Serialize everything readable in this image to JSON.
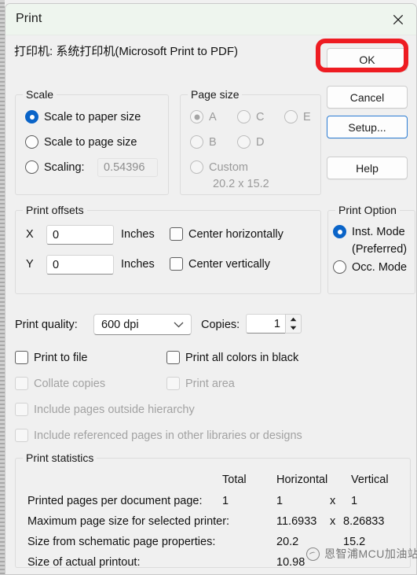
{
  "window": {
    "title": "Print",
    "close_icon": "close-icon"
  },
  "printer": {
    "label": "打印机: 系统打印机(Microsoft Print to PDF)"
  },
  "buttons": {
    "ok": "OK",
    "cancel": "Cancel",
    "setup": "Setup...",
    "help": "Help"
  },
  "annotation": {
    "highlight_color": "#ee1c22",
    "target": "OK"
  },
  "scale": {
    "legend": "Scale",
    "options": [
      {
        "label": "Scale to paper size",
        "selected": true,
        "disabled": false
      },
      {
        "label": "Scale to page size",
        "selected": false,
        "disabled": false
      },
      {
        "label": "Scaling:",
        "selected": false,
        "disabled": false
      }
    ],
    "scaling_value": "0.54396"
  },
  "page_size": {
    "legend": "Page size",
    "options": [
      {
        "label": "A",
        "selected": true,
        "disabled": true
      },
      {
        "label": "C",
        "selected": false,
        "disabled": true
      },
      {
        "label": "E",
        "selected": false,
        "disabled": true
      },
      {
        "label": "B",
        "selected": false,
        "disabled": true
      },
      {
        "label": "D",
        "selected": false,
        "disabled": true
      },
      {
        "label": "Custom",
        "selected": false,
        "disabled": true
      }
    ],
    "custom_dimensions": "20.2 x 15.2"
  },
  "print_offsets": {
    "legend": "Print offsets",
    "x_label": "X",
    "x_value": "0",
    "x_units": "Inches",
    "y_label": "Y",
    "y_value": "0",
    "y_units": "Inches",
    "center_horizontally": {
      "label": "Center horizontally",
      "checked": false
    },
    "center_vertically": {
      "label": "Center vertically",
      "checked": false
    }
  },
  "print_option": {
    "legend": "Print Option",
    "options": [
      {
        "label": "Inst. Mode",
        "sublabel": "(Preferred)",
        "selected": true
      },
      {
        "label": "Occ. Mode",
        "sublabel": "",
        "selected": false
      }
    ]
  },
  "quality": {
    "label": "Print quality:",
    "value": "600 dpi",
    "chevron_icon": "chevron-down-icon"
  },
  "copies": {
    "label": "Copies:",
    "value": "1",
    "up_icon": "caret-up-icon",
    "down_icon": "caret-down-icon"
  },
  "checkboxes": [
    {
      "label": "Print to file",
      "checked": false,
      "disabled": false
    },
    {
      "label": "Print all colors in black",
      "checked": false,
      "disabled": false
    },
    {
      "label": "Collate copies",
      "checked": false,
      "disabled": true
    },
    {
      "label": "Print area",
      "checked": false,
      "disabled": true
    },
    {
      "label": "Include pages outside hierarchy",
      "checked": false,
      "disabled": true
    },
    {
      "label": "Include referenced pages in other libraries or designs",
      "checked": false,
      "disabled": true
    }
  ],
  "statistics": {
    "legend": "Print statistics",
    "columns": {
      "total": "Total",
      "horizontal": "Horizontal",
      "vertical": "Vertical"
    },
    "rows": [
      {
        "label": "Printed pages per document page:",
        "total": "1",
        "horizontal": "1",
        "separator": "x",
        "vertical": "1"
      },
      {
        "label": "Maximum page size for selected printer:",
        "total": "",
        "horizontal": "11.6933",
        "separator": "x",
        "vertical": "8.26833"
      },
      {
        "label": "Size from schematic page properties:",
        "total": "",
        "horizontal": "20.2",
        "separator": "",
        "vertical": "15.2"
      },
      {
        "label": "Size of actual printout:",
        "total": "",
        "horizontal": "10.98",
        "separator": "",
        "vertical": ""
      }
    ]
  },
  "watermark": {
    "text": "恩智浦MCU加油站",
    "logo_icon": "circular-logo-icon"
  }
}
